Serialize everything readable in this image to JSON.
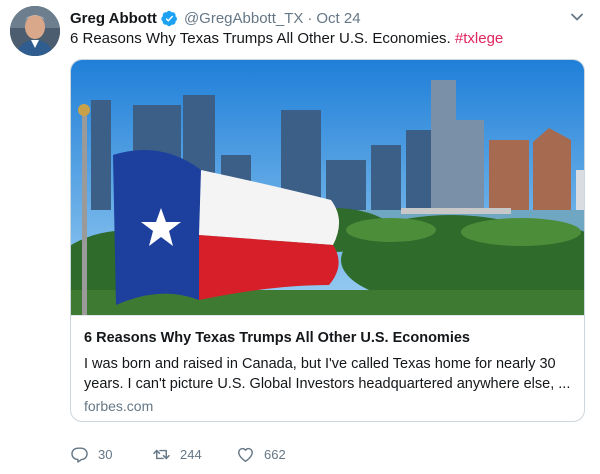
{
  "tweet": {
    "author": {
      "display_name": "Greg Abbott",
      "handle": "@GregAbbott_TX",
      "separator": "·",
      "date": "Oct 24",
      "verified": true
    },
    "text": "6 Reasons Why Texas Trumps All Other U.S. Economies.",
    "hashtag": "#txlege",
    "card": {
      "title": "6 Reasons Why Texas Trumps All Other U.S. Economies",
      "description": "I was born and raised in Canada, but I've called Texas home for nearly 30 years. I can't picture U.S. Global Investors headquartered anywhere else, ...",
      "domain": "forbes.com"
    },
    "actions": {
      "replies": "30",
      "retweets": "244",
      "likes": "662"
    }
  },
  "colors": {
    "hashtag": "#e0245e",
    "verified": "#1da1f2",
    "muted": "#657786"
  },
  "icons": [
    "verified-badge-icon",
    "chevron-down-icon",
    "reply-icon",
    "retweet-icon",
    "like-icon"
  ]
}
